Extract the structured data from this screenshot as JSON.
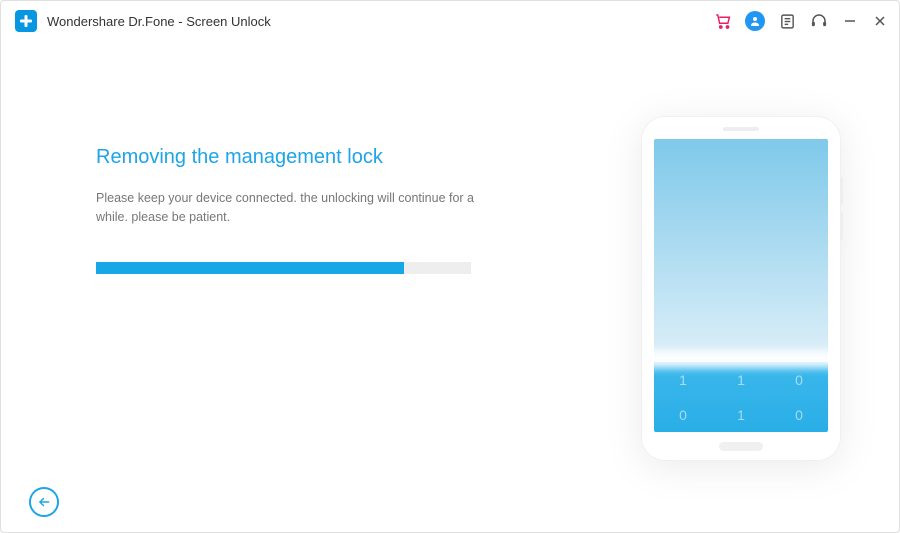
{
  "app": {
    "title": "Wondershare Dr.Fone - Screen Unlock"
  },
  "main": {
    "heading": "Removing the management lock",
    "subtext": "Please keep your device connected. the unlocking will continue for a while. please be patient.",
    "progress_percent": 82
  },
  "phone": {
    "keypad": [
      "1",
      "1",
      "0",
      "0",
      "1",
      "0"
    ]
  },
  "colors": {
    "accent": "#1ea4e8",
    "progress": "#17a6e6"
  }
}
